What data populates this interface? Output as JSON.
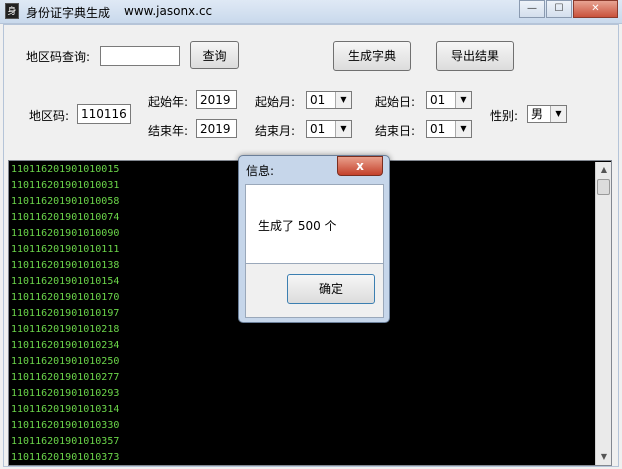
{
  "window": {
    "icon_text": "身",
    "title": "身份证字典生成",
    "url": "www.jasonx.cc",
    "minimize": "—",
    "maximize": "☐",
    "close": "✕"
  },
  "query": {
    "label": "地区码查询:",
    "value": "",
    "button": "查询"
  },
  "actions": {
    "generate": "生成字典",
    "export": "导出结果"
  },
  "form": {
    "area_label": "地区码:",
    "area_value": "110116",
    "start_year_label": "起始年:",
    "start_year": "2019",
    "end_year_label": "结束年:",
    "end_year": "2019",
    "start_month_label": "起始月:",
    "start_month": "01",
    "end_month_label": "结束月:",
    "end_month": "01",
    "start_day_label": "起始日:",
    "start_day": "01",
    "end_day_label": "结束日:",
    "end_day": "01",
    "gender_label": "性别:",
    "gender": "男"
  },
  "output_lines": [
    "110116201901010015",
    "110116201901010031",
    "110116201901010058",
    "110116201901010074",
    "110116201901010090",
    "110116201901010111",
    "110116201901010138",
    "110116201901010154",
    "110116201901010170",
    "110116201901010197",
    "110116201901010218",
    "110116201901010234",
    "110116201901010250",
    "110116201901010277",
    "110116201901010293",
    "110116201901010314",
    "110116201901010330",
    "110116201901010357",
    "110116201901010373"
  ],
  "dialog": {
    "title": "信息:",
    "close": "x",
    "message": "生成了 500 个",
    "ok": "确定"
  },
  "colors": {
    "output_text": "#6bd64a",
    "output_bg": "#000000",
    "close_red": "#c9523c"
  }
}
